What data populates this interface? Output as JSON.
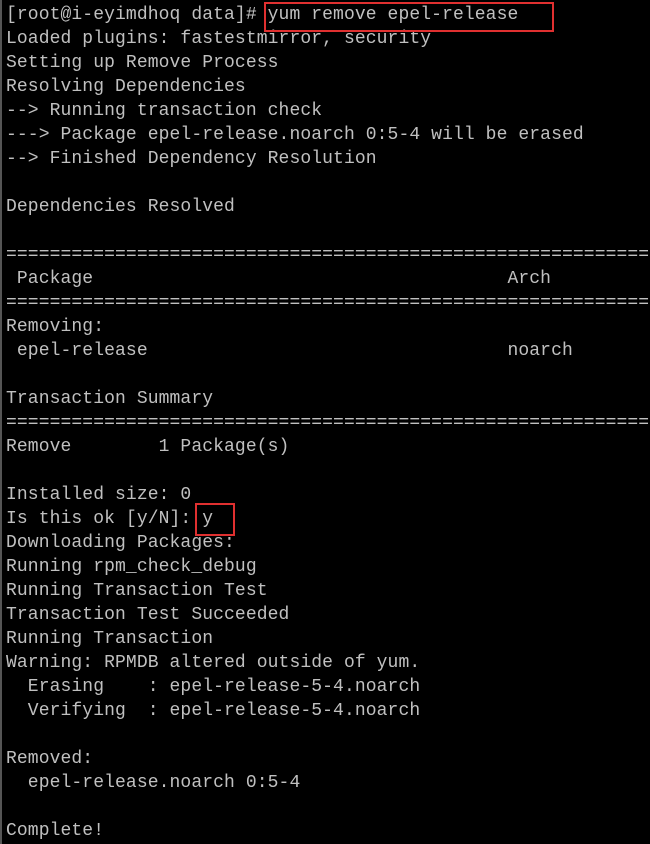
{
  "terminal": {
    "colors": {
      "background": "#000000",
      "text": "#c0c0c0",
      "highlight": "#e03030"
    },
    "lines": [
      "[root@i-eyimdhoq data]# yum remove epel-release",
      "Loaded plugins: fastestmirror, security",
      "Setting up Remove Process",
      "Resolving Dependencies",
      "--> Running transaction check",
      "---> Package epel-release.noarch 0:5-4 will be erased",
      "--> Finished Dependency Resolution",
      "",
      "Dependencies Resolved",
      "",
      "============================================================",
      " Package                                      Arch",
      "============================================================",
      "Removing:",
      " epel-release                                 noarch",
      "",
      "Transaction Summary",
      "============================================================",
      "Remove        1 Package(s)",
      "",
      "Installed size: 0",
      "Is this ok [y/N]: y",
      "Downloading Packages:",
      "Running rpm_check_debug",
      "Running Transaction Test",
      "Transaction Test Succeeded",
      "Running Transaction",
      "Warning: RPMDB altered outside of yum.",
      "  Erasing    : epel-release-5-4.noarch",
      "  Verifying  : epel-release-5-4.noarch",
      "",
      "Removed:",
      "  epel-release.noarch 0:5-4",
      "",
      "Complete!"
    ]
  }
}
